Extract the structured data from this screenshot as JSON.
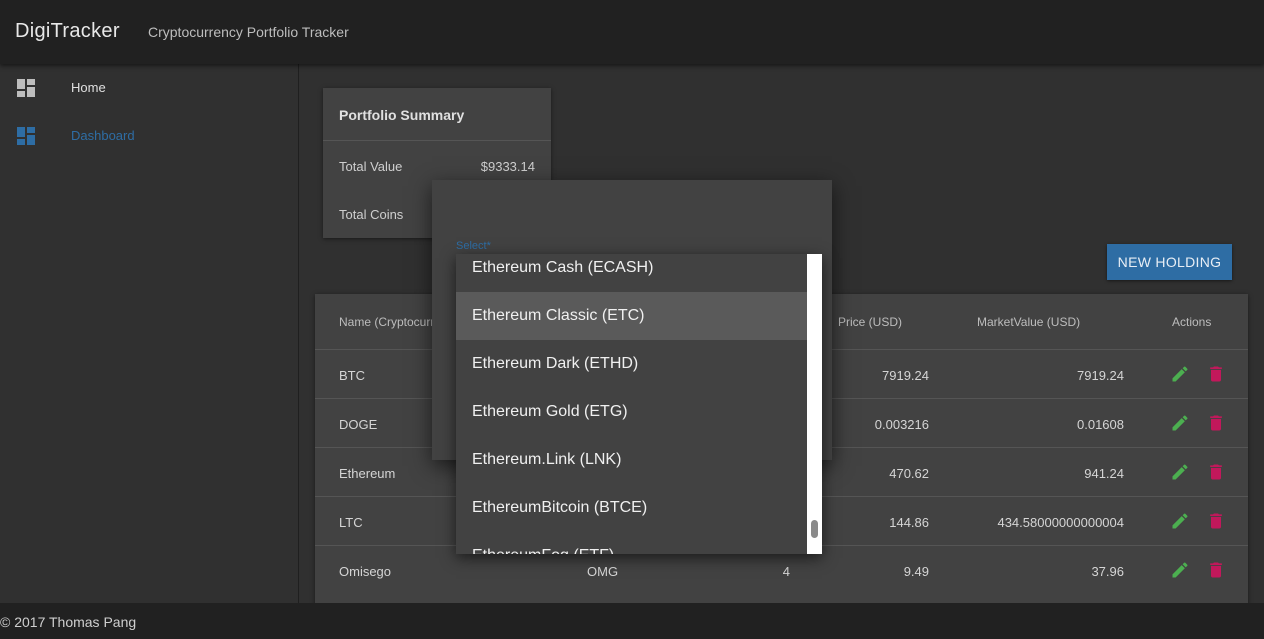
{
  "app": {
    "title": "DigiTracker",
    "subtitle": "Cryptocurrency Portfolio Tracker"
  },
  "sidebar": {
    "items": [
      {
        "label": "Home",
        "icon": "dashboard-icon"
      },
      {
        "label": "Dashboard",
        "icon": "dashboard-icon"
      }
    ]
  },
  "summary": {
    "title": "Portfolio Summary",
    "total_value_label": "Total Value",
    "total_value": "$9333.14",
    "total_coins_label": "Total Coins"
  },
  "toolbar": {
    "new_holding_label": "NEW HOLDING"
  },
  "table": {
    "headers": {
      "name": "Name (Cryptocurrency)",
      "price": "Price (USD)",
      "market": "MarketValue (USD)",
      "actions": "Actions"
    },
    "rows": [
      {
        "name": "BTC",
        "symbol": "",
        "quantity": "",
        "price": "7919.24",
        "market": "7919.24"
      },
      {
        "name": "DOGE",
        "symbol": "",
        "quantity": "",
        "price": "0.003216",
        "market": "0.01608"
      },
      {
        "name": "Ethereum",
        "symbol": "",
        "quantity": "",
        "price": "470.62",
        "market": "941.24"
      },
      {
        "name": "LTC",
        "symbol": "",
        "quantity": "",
        "price": "144.86",
        "market": "434.58000000000004"
      },
      {
        "name": "Omisego",
        "symbol": "OMG",
        "quantity": "4",
        "price": "9.49",
        "market": "37.96"
      }
    ]
  },
  "dialog": {
    "select_label": "Select*"
  },
  "dropdown": {
    "options": [
      "Ethereum Cash (ECASH)",
      "Ethereum Classic (ETC)",
      "Ethereum Dark (ETHD)",
      "Ethereum Gold (ETG)",
      "Ethereum.Link (LNK)",
      "EthereumBitcoin (BTCE)",
      "EthereumFog (ETF)"
    ],
    "highlighted": "Ethereum Classic (ETC)"
  },
  "footer": {
    "text": "© 2017 Thomas Pang"
  },
  "colors": {
    "accent": "#2e6da4",
    "edit": "#4caf50",
    "delete": "#c2185b"
  }
}
